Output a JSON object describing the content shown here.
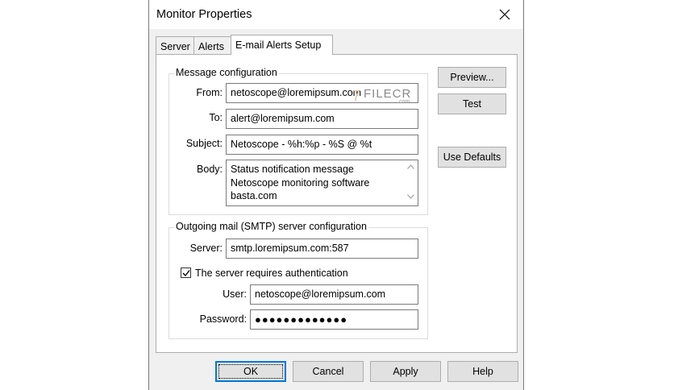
{
  "window": {
    "title": "Monitor Properties"
  },
  "tabs": [
    {
      "label": "Server"
    },
    {
      "label": "Alerts"
    },
    {
      "label": "E-mail Alerts Setup"
    }
  ],
  "message_config": {
    "group_label": "Message configuration",
    "from_label": "From:",
    "from_value": "netoscope@loremipsum.com",
    "to_label": "To:",
    "to_value": "alert@loremipsum.com",
    "subject_label": "Subject:",
    "subject_value": "Netoscope - %h:%p - %S @ %t",
    "body_label": "Body:",
    "body_lines": [
      "Status notification message",
      "Netoscope monitoring software",
      "basta.com"
    ]
  },
  "smtp_config": {
    "group_label": "Outgoing mail (SMTP) server configuration",
    "server_label": "Server:",
    "server_value": "smtp.loremipsum.com:587",
    "auth_label": "The server requires authentication",
    "auth_checked": true,
    "user_label": "User:",
    "user_value": "netoscope@loremipsum.com",
    "password_label": "Password:",
    "password_value": "●●●●●●●●●●●●●"
  },
  "side_buttons": {
    "preview": "Preview...",
    "test": "Test",
    "use_defaults": "Use Defaults"
  },
  "footer_buttons": {
    "ok": "OK",
    "cancel": "Cancel",
    "apply": "Apply",
    "help": "Help"
  },
  "watermark": {
    "mark": "7",
    "text": "FILECR",
    "sub": ".com"
  },
  "colors": {
    "focus_border": "#0078d7",
    "button_face": "#e1e1e1",
    "dialog_bg": "#f0f0f0"
  }
}
